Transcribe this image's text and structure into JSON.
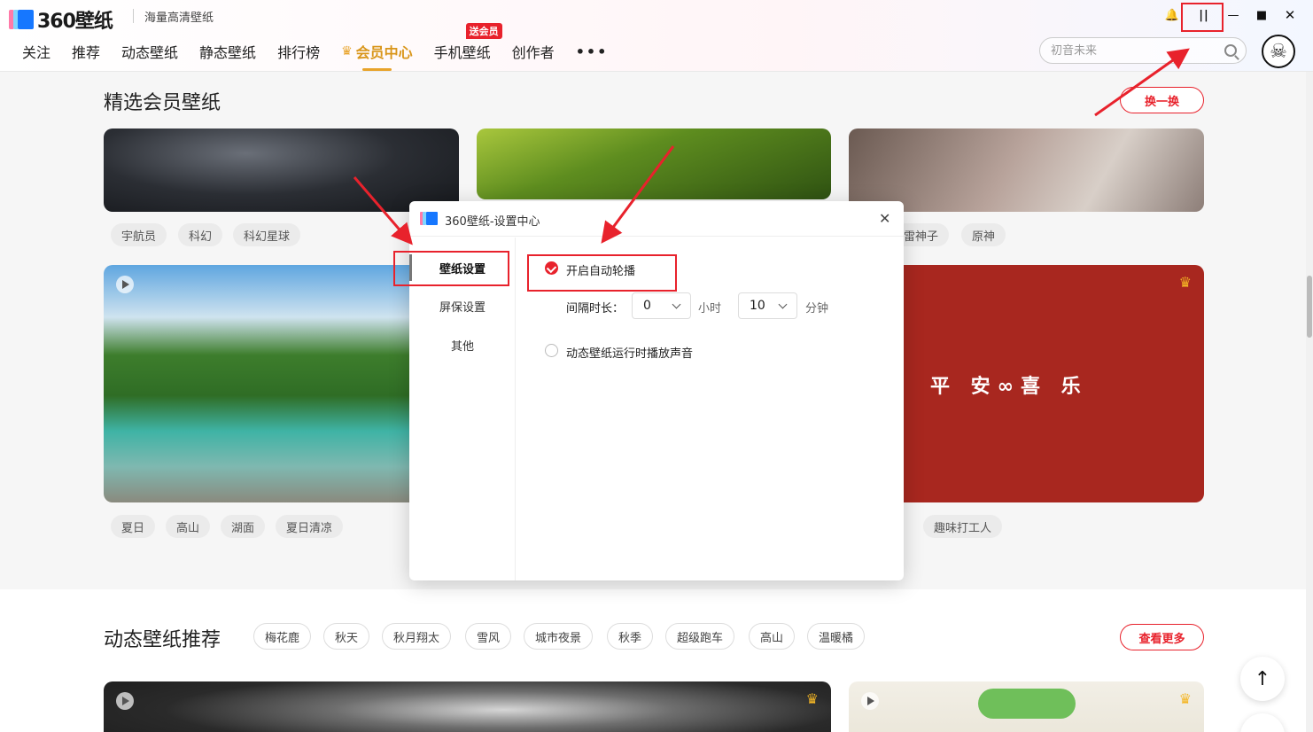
{
  "app": {
    "logo_text": "360壁纸",
    "slogan": "海量高清壁纸"
  },
  "window_controls": {
    "bell": "🔔",
    "pause": "||",
    "minimize": "—",
    "maximize": "■",
    "close": "✕"
  },
  "nav": {
    "items": [
      "关注",
      "推荐",
      "动态壁纸",
      "静态壁纸",
      "排行榜"
    ],
    "active": "会员中心",
    "mobile": "手机壁纸",
    "mobile_badge": "送会员",
    "creator": "创作者",
    "more": "•••"
  },
  "search": {
    "placeholder": "初音未来"
  },
  "section1": {
    "title": "精选会员壁纸",
    "refresh": "换一换",
    "row1_tags_a": [
      "宇航员",
      "科幻",
      "科幻星球"
    ],
    "row1_tags_c": [
      "雷神子",
      "原神"
    ],
    "row2_tags_a": [
      "夏日",
      "高山",
      "湖面",
      "夏日清凉"
    ],
    "row2_tags_c": [
      "趣味打工人"
    ],
    "card_text": "平 安∞喜 乐"
  },
  "section2": {
    "title": "动态壁纸推荐",
    "tags": [
      "梅花鹿",
      "秋天",
      "秋月翔太",
      "雪风",
      "城市夜景",
      "秋季",
      "超级跑车",
      "高山",
      "温暖橘"
    ],
    "more": "查看更多"
  },
  "dialog": {
    "title": "360壁纸-设置中心",
    "close": "✕",
    "sidebar": [
      "壁纸设置",
      "屏保设置",
      "其他"
    ],
    "auto_rotate": "开启自动轮播",
    "interval_label": "间隔时长：",
    "hours_value": "0",
    "hours_unit": "小时",
    "minutes_value": "10",
    "minutes_unit": "分钟",
    "sound_label": "动态壁纸运行时播放声音"
  },
  "misc": {
    "to_top": "↑"
  },
  "colors": {
    "accent_red": "#e8222c",
    "vip_gold": "#e8a32a"
  }
}
